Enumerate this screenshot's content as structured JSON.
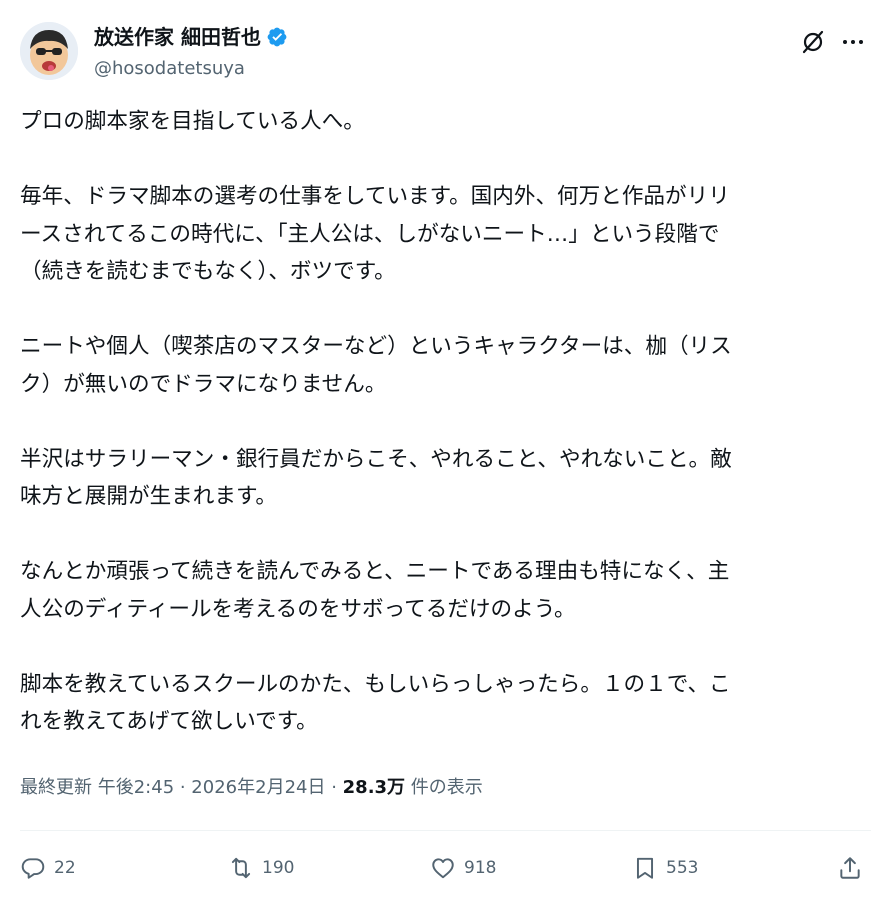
{
  "author": {
    "display_name": "放送作家 細田哲也",
    "handle": "@hosodatetsuya"
  },
  "tweet": {
    "paragraphs": [
      [
        "プロの脚本家を目指している人へ。"
      ],
      [
        "毎年、ドラマ脚本の選考の仕事をしています。国内外、何万と作品がリリ",
        "ースされてるこの時代に、「主人公は、しがないニート…」という段階で",
        "（続きを読むまでもなく）、ボツです。"
      ],
      [
        "ニートや個人（喫茶店のマスターなど）というキャラクターは、枷（リス",
        "ク）が無いのでドラマになりません。"
      ],
      [
        "半沢はサラリーマン・銀行員だからこそ、やれること、やれないこと。敵",
        "味方と展開が生まれます。"
      ],
      [
        "なんとか頑張って続きを読んでみると、ニートである理由も特になく、主",
        "人公のディティールを考えるのをサボってるだけのよう。"
      ],
      [
        "脚本を教えているスクールのかた、もしいらっしゃったら。１の１で、こ",
        "れを教えてあげて欲しいです。"
      ]
    ]
  },
  "meta": {
    "prefix": "最終更新 午後2:45 · 2026年2月24日 · ",
    "views": "28.3万",
    "views_suffix": " 件の表示"
  },
  "actions": {
    "reply": "22",
    "repost": "190",
    "like": "918",
    "bookmark": "553"
  },
  "colors": {
    "verified": "#1d9bf0",
    "secondary_text": "#536471",
    "primary_text": "#0f1419"
  },
  "icons": {
    "top": [
      "grok-icon",
      "more-icon"
    ],
    "actions": [
      "reply-icon",
      "repost-icon",
      "like-icon",
      "bookmark-icon",
      "share-icon"
    ]
  }
}
